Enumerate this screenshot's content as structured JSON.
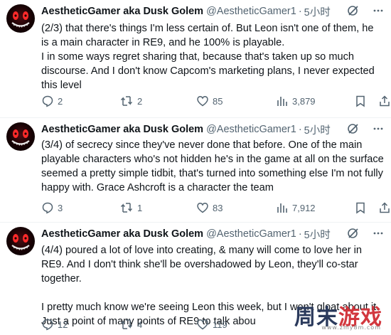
{
  "tweets": [
    {
      "name": "AestheticGamer aka Dusk Golem",
      "handle": "@AestheticGamer1",
      "time": "5小时",
      "text": "(2/3) that there's things I'm less certain of. But Leon isn't one of them, he is a main character in RE9, and he 100% is playable.\nI in some ways regret sharing that, because that's taken up so much discourse. And I don't know Capcom's marketing plans, I never expected this level",
      "replies": "2",
      "retweets": "2",
      "likes": "85",
      "views": "3,879"
    },
    {
      "name": "AestheticGamer aka Dusk Golem",
      "handle": "@AestheticGamer1",
      "time": "5小时",
      "text": "(3/4) of secrecy since they've never done that before. One of the main playable characters who's not hidden he's in the game at all on the surface seemed a pretty simple tidbit, that's turned into something else I'm not fully happy with. Grace Ashcroft is a character the team",
      "replies": "3",
      "retweets": "1",
      "likes": "83",
      "views": "7,912"
    },
    {
      "name": "AestheticGamer aka Dusk Golem",
      "handle": "@AestheticGamer1",
      "time": "5小时",
      "text": "(4/4) poured a lot of love into creating, & many will come to love her in RE9. And I don't think she'll be overshadowed by Leon, they'll co-star together.\n\nI pretty much know we're seeing Leon this week, but I won't gloat about it. Just a point of many points of RE9 to talk abou",
      "replies": "12",
      "retweets": "4",
      "likes": "119",
      "views": ""
    }
  ],
  "watermark": {
    "brand_a": "周末",
    "brand_b": "游戏",
    "url": "www.zmy8m.com"
  },
  "icons": {
    "reply": "reply-icon",
    "retweet": "retweet-icon",
    "like": "heart-icon",
    "views": "views-icon",
    "bookmark": "bookmark-icon",
    "share": "share-icon",
    "grok": "grok-icon",
    "more": "more-icon"
  }
}
